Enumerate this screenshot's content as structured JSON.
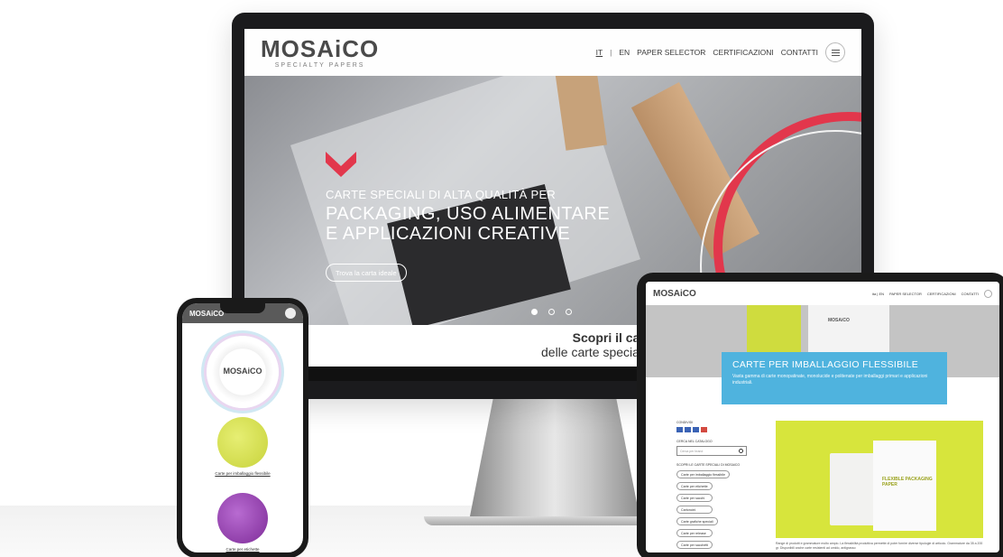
{
  "desktop": {
    "logo_text": "MOSAiCO",
    "logo_sub": "SPECIALTY PAPERS",
    "nav": {
      "lang_it": "IT",
      "lang_sep": "|",
      "lang_en": "EN",
      "paper_selector": "PAPER SELECTOR",
      "certificazioni": "CERTIFICAZIONI",
      "contatti": "CONTATTI"
    },
    "hero": {
      "subtitle": "CARTE SPECIALI DI ALTA QUALITÀ PER",
      "title_line1": "PACKAGING, USO ALIMENTARE",
      "title_line2": "E APPLICAZIONI CREATIVE",
      "cta": "Trova la carta ideale"
    },
    "catalog": {
      "line1": "Scopri il catalogo",
      "line2": "delle carte speciali di Mosaico"
    }
  },
  "phone": {
    "logo": "MOSAiCO",
    "logo_center": "MOSAiCO",
    "caption1": "Carte per imballaggio flessibile",
    "caption2": "Carte per etichette"
  },
  "tablet": {
    "logo": "MOSAiCO",
    "nav": {
      "lang": "ita | EN",
      "paper_selector": "PAPER SELECTOR",
      "certificazioni": "CERTIFICAZIONI",
      "contatti": "CONTATTI"
    },
    "hero_bag_text": "MOSAiCO",
    "banner": {
      "title": "CARTE PER IMBALLAGGIO FLESSIBILE",
      "text": "Vasta gamma di carte monopatinate, monolucide e politenate per imballaggi primari e applicazioni industriali."
    },
    "sidebar": {
      "share_label": "CONDIVIDI",
      "search_label": "CERCA NEL CATALOGO",
      "search_placeholder": "Cerca per brand",
      "discover_label": "SCOPRI LE CARTE SPECIALI DI MOSAICO",
      "items": [
        "Carte per imballaggio flessibile",
        "Carte per etichette",
        "Carte per sacchi",
        "Cartoncini",
        "Carte grafiche speciali",
        "Carte per release",
        "Carte per sacchetti"
      ]
    },
    "product_text": "FLEXIBLE PACKAGING PAPER",
    "product_logo": "MOSAiCO",
    "paragraph": "Range di prodotti e grammature molto ampio. La flessibilità produttiva permette di poter fornire diverse tipologie di articolo. Grammature da 35 a 200 gr. Disponibili anche carte resistenti ad umido, antigrasso"
  },
  "colors": {
    "accent": "#e2374c",
    "blue": "#4fb3de",
    "lime": "#d7e53c"
  }
}
